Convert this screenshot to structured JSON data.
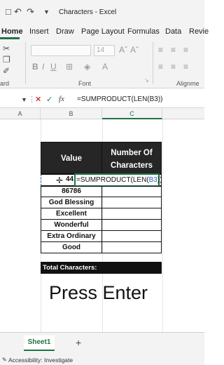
{
  "app": {
    "title": "Characters  -  Excel"
  },
  "ribbon": {
    "tabs": [
      "Home",
      "Insert",
      "Draw",
      "Page Layout",
      "Formulas",
      "Data",
      "Revie"
    ],
    "font_size": "14",
    "group_labels": {
      "clipboard": "ard",
      "font": "Font",
      "alignment": "Alignme"
    }
  },
  "formula_bar": {
    "fx": "fx",
    "formula": "=SUMPRODUCT(LEN(B3))"
  },
  "columns": [
    "A",
    "B",
    "C"
  ],
  "table": {
    "header_value": "Value",
    "header_count_line1": "Number Of",
    "header_count_line2": "Characters",
    "editing_value": "44",
    "editing_formula_prefix": "=SUMPRODUCT(LEN(",
    "editing_formula_ref": "B3",
    "editing_formula_suffix": "))",
    "rows": [
      "86786",
      "God Blessing",
      "Excellent",
      "Wonderful",
      "Extra Ordinary",
      "Good"
    ],
    "total_label": "Total Characters:"
  },
  "overlay_text": "Press Enter",
  "sheet": {
    "tab": "Sheet1",
    "add": "+"
  },
  "status": {
    "text": "Accessibility: Investigate"
  },
  "colors": {
    "accent": "#217346",
    "header_bg": "#262626",
    "ref_blue": "#2f5fb8"
  }
}
